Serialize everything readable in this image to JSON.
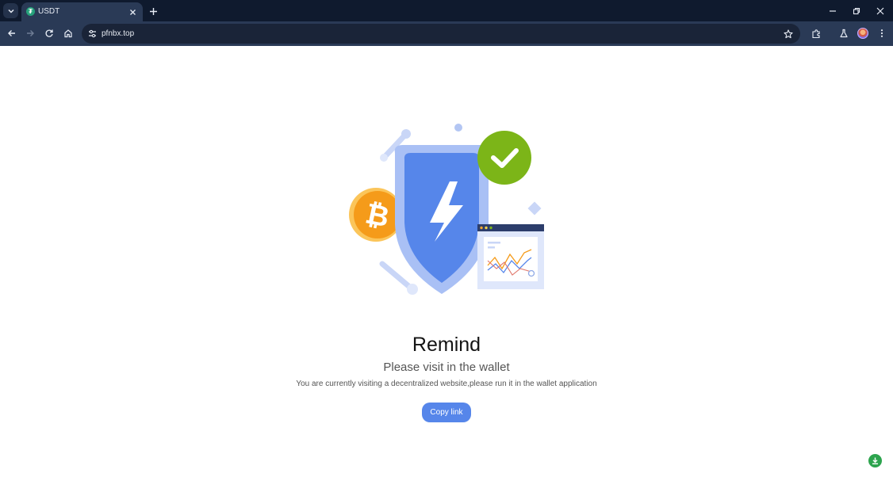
{
  "browser": {
    "tab": {
      "title": "USDT",
      "favicon": "usdt-tether-icon"
    },
    "address_bar": {
      "url": "pfnbx.top"
    },
    "icons": {
      "tab_search": "chevron-down-icon",
      "new_tab": "plus-icon",
      "back": "arrow-left-icon",
      "forward": "arrow-right-icon",
      "reload": "reload-icon",
      "home": "home-icon",
      "site_info": "tune-icon",
      "bookmark": "star-icon",
      "extensions": "puzzle-icon",
      "labs": "flask-icon",
      "menu": "kebab-menu-icon"
    },
    "colors": {
      "frame": "#0f1a2e",
      "toolbar": "#2a3a56",
      "omnibox": "#1a2438"
    }
  },
  "page": {
    "heading": "Remind",
    "subheading": "Please visit in the wallet",
    "description": "You are currently visiting a decentralized website,please run it in the wallet application",
    "copy_button": "Copy link",
    "colors": {
      "accent": "#5686ea",
      "check": "#7cb518",
      "bitcoin": "#f59b1a"
    }
  }
}
